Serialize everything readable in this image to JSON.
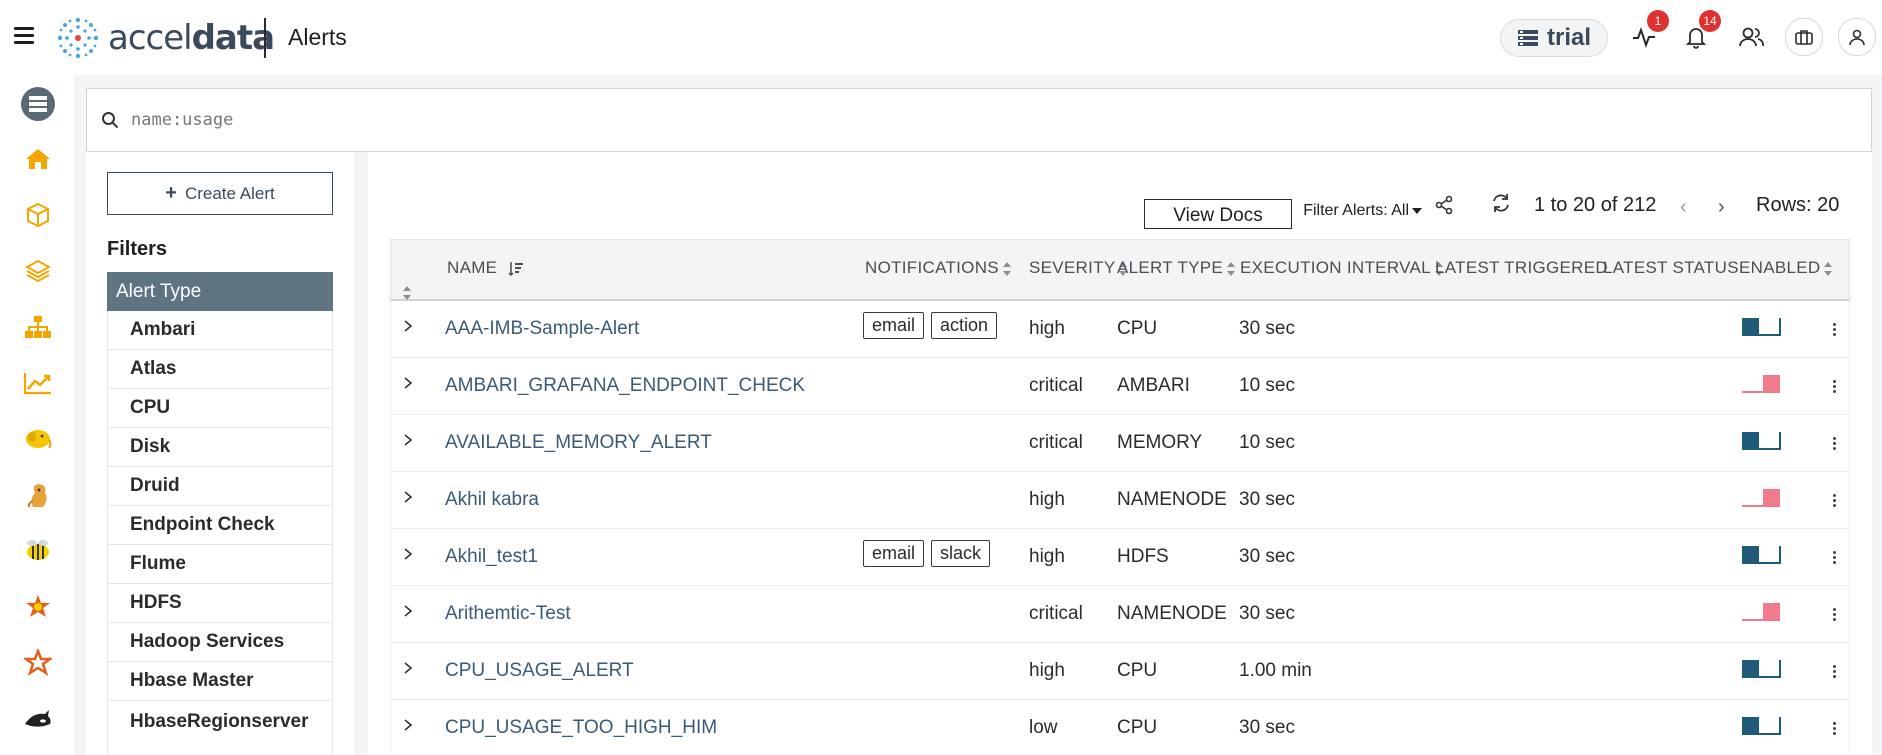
{
  "header": {
    "brand": "accel",
    "brand_bold": "data",
    "page_title": "Alerts",
    "workspace": "trial",
    "activity_badge": "1",
    "notifications_badge": "14"
  },
  "search": {
    "value": "",
    "placeholder": "name:usage"
  },
  "filters": {
    "create_label": "Create Alert",
    "title": "Filters",
    "group_header": "Alert Type",
    "items": [
      "Ambari",
      "Atlas",
      "CPU",
      "Disk",
      "Druid",
      "Endpoint Check",
      "Flume",
      "HDFS",
      "Hadoop Services",
      "Hbase Master"
    ],
    "last_item_line1": "Hbase",
    "last_item_line2": "Regionserver"
  },
  "toolbar": {
    "view_docs": "View Docs",
    "filter_alerts": "Filter Alerts: All",
    "paging": "1 to 20 of 212",
    "prev": "‹",
    "next": "›",
    "rows": "Rows: 20"
  },
  "table": {
    "columns": {
      "name": "NAME",
      "notifications": "NOTIFICATIONS",
      "severity": "SEVERITY",
      "alert_type": "ALERT TYPE",
      "execution_interval": "EXECUTION INTERVAL",
      "latest_triggered": "LATEST TRIGGERED",
      "latest_status": "LATEST STATUS",
      "enabled": "ENABLED"
    },
    "rows": [
      {
        "name": "AAA-IMB-Sample-Alert",
        "notifications": [
          "email",
          "action"
        ],
        "severity": "high",
        "type": "CPU",
        "interval": "30 sec",
        "enabled": true
      },
      {
        "name": "AMBARI_GRAFANA_ENDPOINT_CHECK",
        "notifications": [],
        "severity": "critical",
        "type": "AMBARI",
        "interval": "10 sec",
        "enabled": false
      },
      {
        "name": "AVAILABLE_MEMORY_ALERT",
        "notifications": [],
        "severity": "critical",
        "type": "MEMORY",
        "interval": "10 sec",
        "enabled": true
      },
      {
        "name": "Akhil kabra",
        "notifications": [],
        "severity": "high",
        "type": "NAMENODE",
        "interval": "30 sec",
        "enabled": false
      },
      {
        "name": "Akhil_test1",
        "notifications": [
          "email",
          "slack"
        ],
        "severity": "high",
        "type": "HDFS",
        "interval": "30 sec",
        "enabled": true
      },
      {
        "name": "Arithemtic-Test",
        "notifications": [],
        "severity": "critical",
        "type": "NAMENODE",
        "interval": "30 sec",
        "enabled": false
      },
      {
        "name": "CPU_USAGE_ALERT",
        "notifications": [],
        "severity": "high",
        "type": "CPU",
        "interval": "1.00 min",
        "enabled": true
      },
      {
        "name": "CPU_USAGE_TOO_HIGH_HIM",
        "notifications": [],
        "severity": "low",
        "type": "CPU",
        "interval": "30 sec",
        "enabled": true
      }
    ]
  },
  "colors": {
    "toggle_on": "#1f5a78",
    "toggle_off": "#f07b8c",
    "filter_header_bg": "#5f7483",
    "badge": "#e03131"
  }
}
